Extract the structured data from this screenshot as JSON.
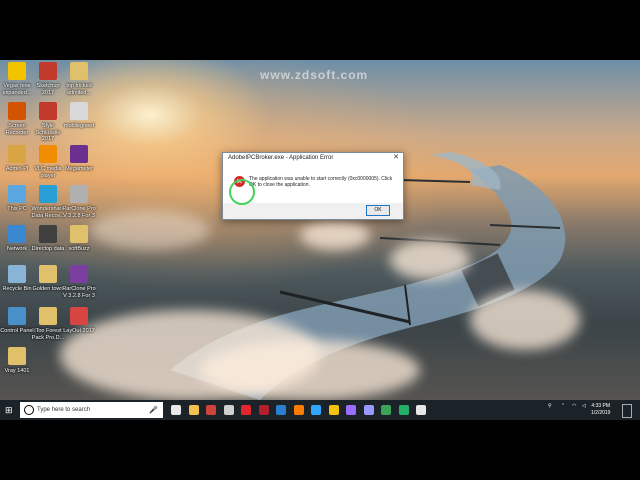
{
  "watermark": "www.zdsoft.com",
  "desktop_icons": [
    {
      "label": "Vegas nine\nexpanded...",
      "color": "#f2c400",
      "icon": "film-icon"
    },
    {
      "label": "Sketchup\n2017",
      "color": "#c0392b",
      "icon": "sketchup-icon"
    },
    {
      "label": "top tricked\nadmited...",
      "color": "#e0c06a",
      "icon": "document-icon"
    },
    {
      "label": "Screen\nRecorder",
      "color": "#d35400",
      "icon": "record-icon"
    },
    {
      "label": "Style Schlüsslle\n2017",
      "color": "#c0392b",
      "icon": "sketchup-icon"
    },
    {
      "label": "mobilegreed",
      "color": "#d9d9d9",
      "icon": "document-icon"
    },
    {
      "label": "Admin-Pl",
      "color": "#d8a542",
      "icon": "user-folder-icon"
    },
    {
      "label": "VLC media\nplayer",
      "color": "#f28c00",
      "icon": "vlc-icon"
    },
    {
      "label": "Megameter",
      "color": "#6a2f8f",
      "icon": "winrar-icon"
    },
    {
      "label": "This PC",
      "color": "#5aa6e0",
      "icon": "computer-icon"
    },
    {
      "label": "Wondershare\nData Recov...",
      "color": "#2a9fd6",
      "icon": "recovery-icon"
    },
    {
      "label": "RarClone Pro\nV 3.2.8 For 3",
      "color": "#b0b0b0",
      "icon": "document-icon"
    },
    {
      "label": "Network",
      "color": "#3a88d0",
      "icon": "network-icon"
    },
    {
      "label": "Directop data",
      "color": "#3f3f3f",
      "icon": "app-icon"
    },
    {
      "label": "softBuzz",
      "color": "#e0c06a",
      "icon": "folder-icon"
    },
    {
      "label": "Recycle Bin",
      "color": "#8ab4d6",
      "icon": "recycle-bin-icon"
    },
    {
      "label": "Golden town",
      "color": "#e0c06a",
      "icon": "folder-icon"
    },
    {
      "label": "RarClone Pro\nV 3.2.8 For 3",
      "color": "#7a3fa0",
      "icon": "winrar-icon"
    },
    {
      "label": "Control Panel",
      "color": "#4a90c8",
      "icon": "control-panel-icon"
    },
    {
      "label": "iToo Forest\nPack Pro.D...",
      "color": "#e0c06a",
      "icon": "folder-icon"
    },
    {
      "label": "LayOut 2017",
      "color": "#d64541",
      "icon": "layout-icon"
    },
    {
      "label": "Vray 1401",
      "color": "#e0c06a",
      "icon": "folder-icon"
    }
  ],
  "dialog": {
    "title": "AdobeIPCBroker.exe - Application Error",
    "close": "✕",
    "message": "The application was unable to start correctly (0xc0000005). Click OK to close the application.",
    "ok_label": "OK"
  },
  "taskbar": {
    "start_glyph": "⊞",
    "search_placeholder": "Type here to search",
    "mic_glyph": "🎤",
    "apps": [
      {
        "name": "task-view",
        "color": "#e8e8e8"
      },
      {
        "name": "file-explorer",
        "color": "#f2c14e"
      },
      {
        "name": "sketchup",
        "color": "#d0433a"
      },
      {
        "name": "film",
        "color": "#cfcfcf"
      },
      {
        "name": "opera",
        "color": "#e3262d"
      },
      {
        "name": "media",
        "color": "#b21f2d"
      },
      {
        "name": "recorder",
        "color": "#2b7fd1"
      },
      {
        "name": "illustrator",
        "color": "#ff7c00"
      },
      {
        "name": "photoshop",
        "color": "#31a8ff"
      },
      {
        "name": "chrome",
        "color": "#f4c20d"
      },
      {
        "name": "premiere",
        "color": "#9b6cff"
      },
      {
        "name": "after-effects",
        "color": "#9999ff"
      },
      {
        "name": "green-app",
        "color": "#3aa356"
      },
      {
        "name": "edge-app",
        "color": "#25b06a"
      },
      {
        "name": "active-window",
        "color": "#e6e6e6"
      }
    ],
    "time": "4:33 PM",
    "date": "1/2/2019"
  }
}
